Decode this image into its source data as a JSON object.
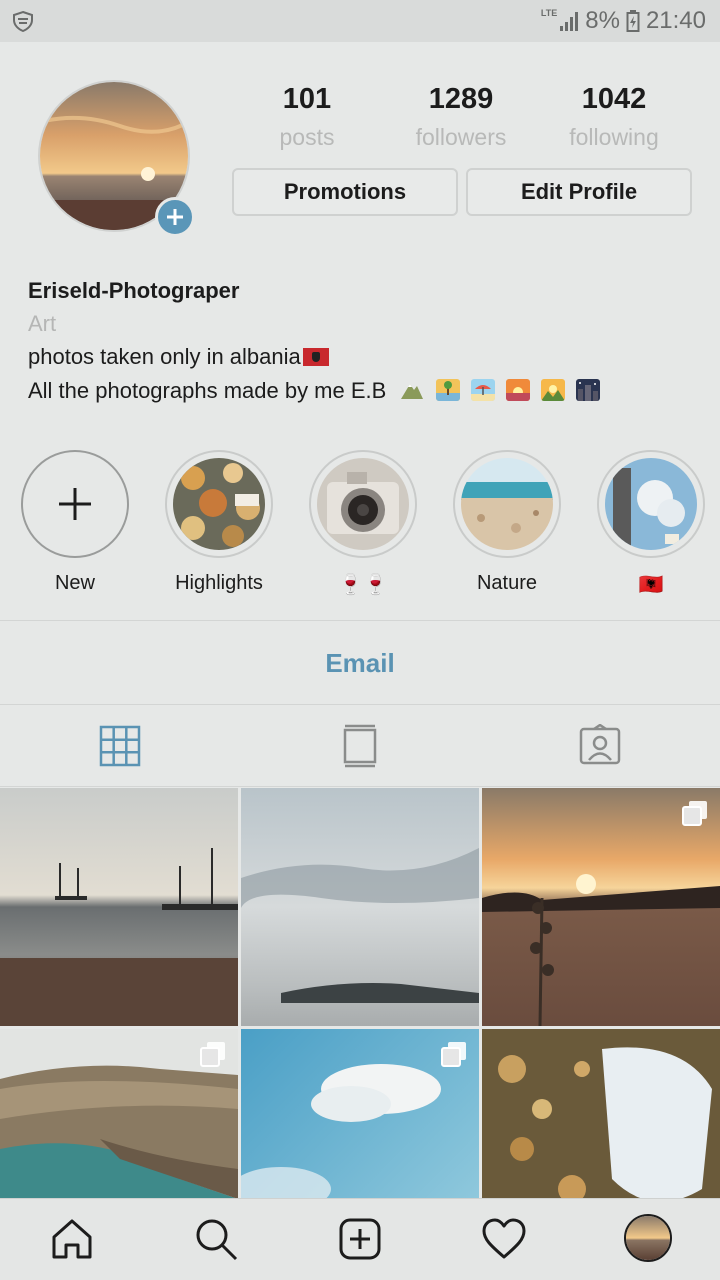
{
  "status_bar": {
    "network": "LTE",
    "battery": "8%",
    "time": "21:40"
  },
  "profile": {
    "stats": [
      {
        "value": "101",
        "label": "posts"
      },
      {
        "value": "1289",
        "label": "followers"
      },
      {
        "value": "1042",
        "label": "following"
      }
    ],
    "buttons": {
      "promotions": "Promotions",
      "edit_profile": "Edit Profile"
    },
    "bio": {
      "name": "Eriseld-Photograper",
      "category": "Art",
      "line1": "photos taken only in albania",
      "line2": "All the photographs made by me E.B"
    }
  },
  "highlights": [
    {
      "label": "New"
    },
    {
      "label": "Highlights"
    },
    {
      "label": "🍷🍷"
    },
    {
      "label": "Nature"
    },
    {
      "label": "🇦🇱"
    }
  ],
  "contact": {
    "email_label": "Email"
  },
  "tabs": [
    {
      "icon": "grid-icon",
      "active": true
    },
    {
      "icon": "feed-icon",
      "active": false
    },
    {
      "icon": "tagged-icon",
      "active": false
    }
  ],
  "posts": [
    {
      "scene": "sea-with-boats",
      "multiple": false
    },
    {
      "scene": "cloudy-sky-over-sea",
      "multiple": false
    },
    {
      "scene": "sunset-plant",
      "multiple": true
    },
    {
      "scene": "coastal-hills",
      "multiple": true
    },
    {
      "scene": "blue-sky-clouds",
      "multiple": true
    },
    {
      "scene": "dry-flowers",
      "multiple": false
    }
  ],
  "bottom_nav": [
    {
      "icon": "home-icon"
    },
    {
      "icon": "search-icon"
    },
    {
      "icon": "add-post-icon"
    },
    {
      "icon": "heart-icon"
    },
    {
      "icon": "profile-avatar"
    }
  ],
  "colors": {
    "accent": "#5a93b3",
    "background": "#e6e8e7",
    "muted_text": "#b8b9b8"
  }
}
